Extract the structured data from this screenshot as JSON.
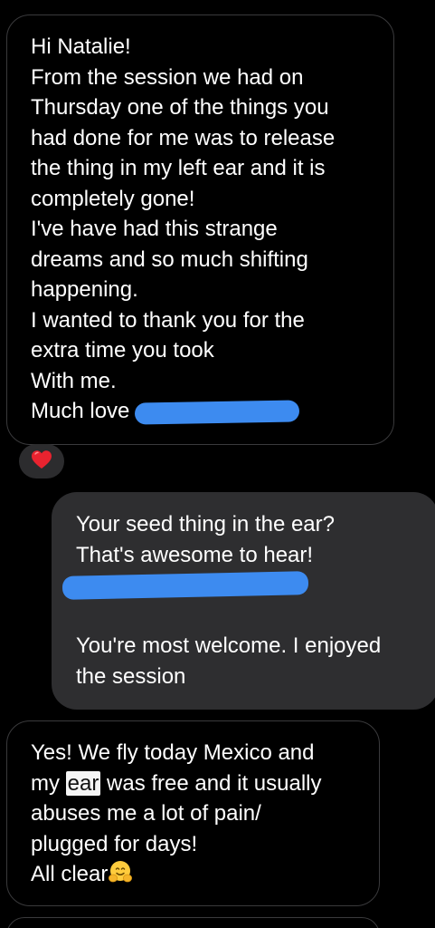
{
  "conversation": {
    "messages": [
      {
        "direction": "incoming",
        "lines": [
          "Hi Natalie!",
          "From the session we had on",
          "Thursday one of the things you",
          "had done for me was to release",
          "the thing in my left ear and it is",
          "completely gone!",
          "I've have had this strange",
          "dreams and so much shifting",
          "happening.",
          "I wanted to thank you for the",
          "extra time you took",
          "With me.",
          "Much love"
        ],
        "reaction": "red-heart-icon"
      },
      {
        "direction": "outgoing",
        "lines": [
          "Your seed thing in the ear?",
          "That's awesome to hear!",
          "You're most welcome. I enjoyed",
          "the session"
        ]
      },
      {
        "direction": "incoming",
        "line1": "Yes! We fly today Mexico and",
        "line2_before": "my ",
        "line2_highlight": "ear",
        "line2_after": " was free and it usually",
        "line3": "abuses me a lot of pain/",
        "line4": "plugged for days!",
        "line5": "All clear",
        "line5_emoji": "hugging-face-icon"
      }
    ]
  },
  "colors": {
    "background": "#000000",
    "incoming_border": "#3a3a3c",
    "outgoing_bubble": "#2e2e30",
    "redaction": "#3d8bf0",
    "reaction_heart": "#e8232f"
  }
}
